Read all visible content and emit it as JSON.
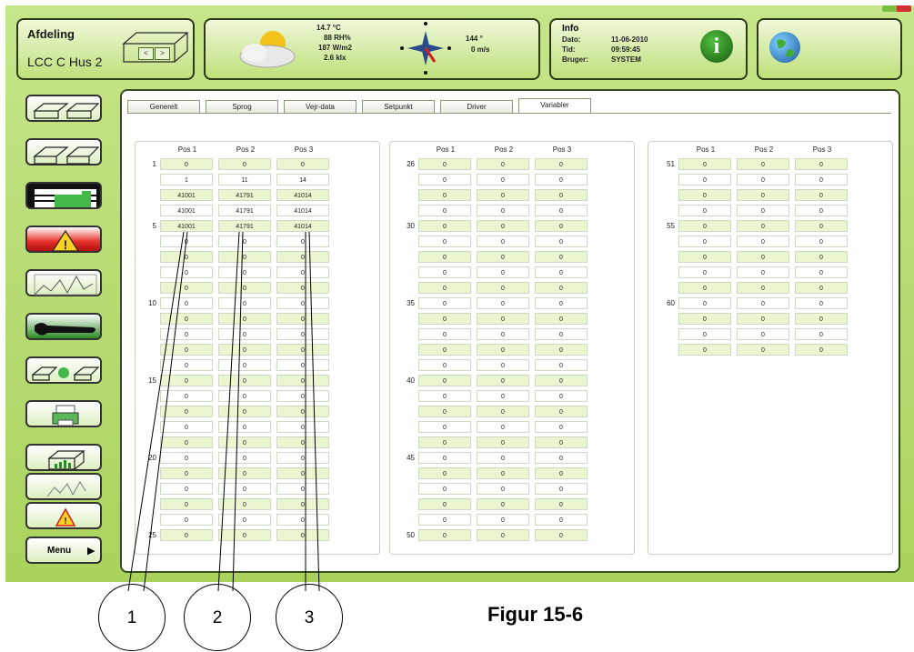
{
  "header": {
    "afdeling_label": "Afdeling",
    "afdeling_name": "LCC C Hus 2",
    "nav_prev": "<",
    "nav_next": ">",
    "weather": {
      "temp": "14.7 °C",
      "rh": "88 RH%",
      "radiation": "187 W/m2",
      "light": "2.6 klx",
      "wind_dir": "144 °",
      "wind_speed": "0 m/s"
    },
    "info": {
      "title": "Info",
      "dato_label": "Dato:",
      "dato": "11-06-2010",
      "tid_label": "Tid:",
      "tid": "09:59:45",
      "bruger_label": "Bruger:",
      "bruger": "SYSTEM"
    }
  },
  "sidebar": {
    "menu_label": "Menu"
  },
  "tabs": [
    "Generelt",
    "Sprog",
    "Vejr-data",
    "Setpunkt",
    "Driver",
    "Variabler"
  ],
  "table": {
    "col_headers": [
      "Pos 1",
      "Pos 2",
      "Pos 3"
    ],
    "panel1": {
      "row_labels": [
        "1",
        "",
        "",
        "",
        "5",
        "",
        "",
        "",
        "",
        "10",
        "",
        "",
        "",
        "",
        "15",
        "",
        "",
        "",
        "",
        "20",
        "",
        "",
        "",
        "",
        "25"
      ],
      "rows": [
        [
          "0",
          "0",
          "0"
        ],
        [
          "1",
          "11",
          "14"
        ],
        [
          "41001",
          "41791",
          "41014"
        ],
        [
          "41001",
          "41791",
          "41014"
        ],
        [
          "41001",
          "41791",
          "41014"
        ],
        [
          "0",
          "0",
          "0"
        ],
        [
          "0",
          "0",
          "0"
        ],
        [
          "0",
          "0",
          "0"
        ],
        [
          "0",
          "0",
          "0"
        ],
        [
          "0",
          "0",
          "0"
        ],
        [
          "0",
          "0",
          "0"
        ],
        [
          "0",
          "0",
          "0"
        ],
        [
          "0",
          "0",
          "0"
        ],
        [
          "0",
          "0",
          "0"
        ],
        [
          "0",
          "0",
          "0"
        ],
        [
          "0",
          "0",
          "0"
        ],
        [
          "0",
          "0",
          "0"
        ],
        [
          "0",
          "0",
          "0"
        ],
        [
          "0",
          "0",
          "0"
        ],
        [
          "0",
          "0",
          "0"
        ],
        [
          "0",
          "0",
          "0"
        ],
        [
          "0",
          "0",
          "0"
        ],
        [
          "0",
          "0",
          "0"
        ],
        [
          "0",
          "0",
          "0"
        ],
        [
          "0",
          "0",
          "0"
        ]
      ]
    },
    "panel2": {
      "row_labels": [
        "26",
        "",
        "",
        "",
        "30",
        "",
        "",
        "",
        "",
        "35",
        "",
        "",
        "",
        "",
        "40",
        "",
        "",
        "",
        "",
        "45",
        "",
        "",
        "",
        "",
        "50"
      ],
      "rows": [
        [
          "0",
          "0",
          "0"
        ],
        [
          "0",
          "0",
          "0"
        ],
        [
          "0",
          "0",
          "0"
        ],
        [
          "0",
          "0",
          "0"
        ],
        [
          "0",
          "0",
          "0"
        ],
        [
          "0",
          "0",
          "0"
        ],
        [
          "0",
          "0",
          "0"
        ],
        [
          "0",
          "0",
          "0"
        ],
        [
          "0",
          "0",
          "0"
        ],
        [
          "0",
          "0",
          "0"
        ],
        [
          "0",
          "0",
          "0"
        ],
        [
          "0",
          "0",
          "0"
        ],
        [
          "0",
          "0",
          "0"
        ],
        [
          "0",
          "0",
          "0"
        ],
        [
          "0",
          "0",
          "0"
        ],
        [
          "0",
          "0",
          "0"
        ],
        [
          "0",
          "0",
          "0"
        ],
        [
          "0",
          "0",
          "0"
        ],
        [
          "0",
          "0",
          "0"
        ],
        [
          "0",
          "0",
          "0"
        ],
        [
          "0",
          "0",
          "0"
        ],
        [
          "0",
          "0",
          "0"
        ],
        [
          "0",
          "0",
          "0"
        ],
        [
          "0",
          "0",
          "0"
        ],
        [
          "0",
          "0",
          "0"
        ]
      ]
    },
    "panel3": {
      "row_labels": [
        "51",
        "",
        "",
        "",
        "55",
        "",
        "",
        "",
        "",
        "60",
        "",
        "",
        ""
      ],
      "rows": [
        [
          "0",
          "0",
          "0"
        ],
        [
          "0",
          "0",
          "0"
        ],
        [
          "0",
          "0",
          "0"
        ],
        [
          "0",
          "0",
          "0"
        ],
        [
          "0",
          "0",
          "0"
        ],
        [
          "0",
          "0",
          "0"
        ],
        [
          "0",
          "0",
          "0"
        ],
        [
          "0",
          "0",
          "0"
        ],
        [
          "0",
          "0",
          "0"
        ],
        [
          "0",
          "0",
          "0"
        ],
        [
          "0",
          "0",
          "0"
        ],
        [
          "0",
          "0",
          "0"
        ],
        [
          "0",
          "0",
          "0"
        ]
      ]
    }
  },
  "callouts": [
    "1",
    "2",
    "3"
  ],
  "figure_caption": "Figur 15-6",
  "colors": {
    "frame": "#b5dc72",
    "cell_green": "#e9f6d0",
    "alarm_red": "#e02020"
  }
}
